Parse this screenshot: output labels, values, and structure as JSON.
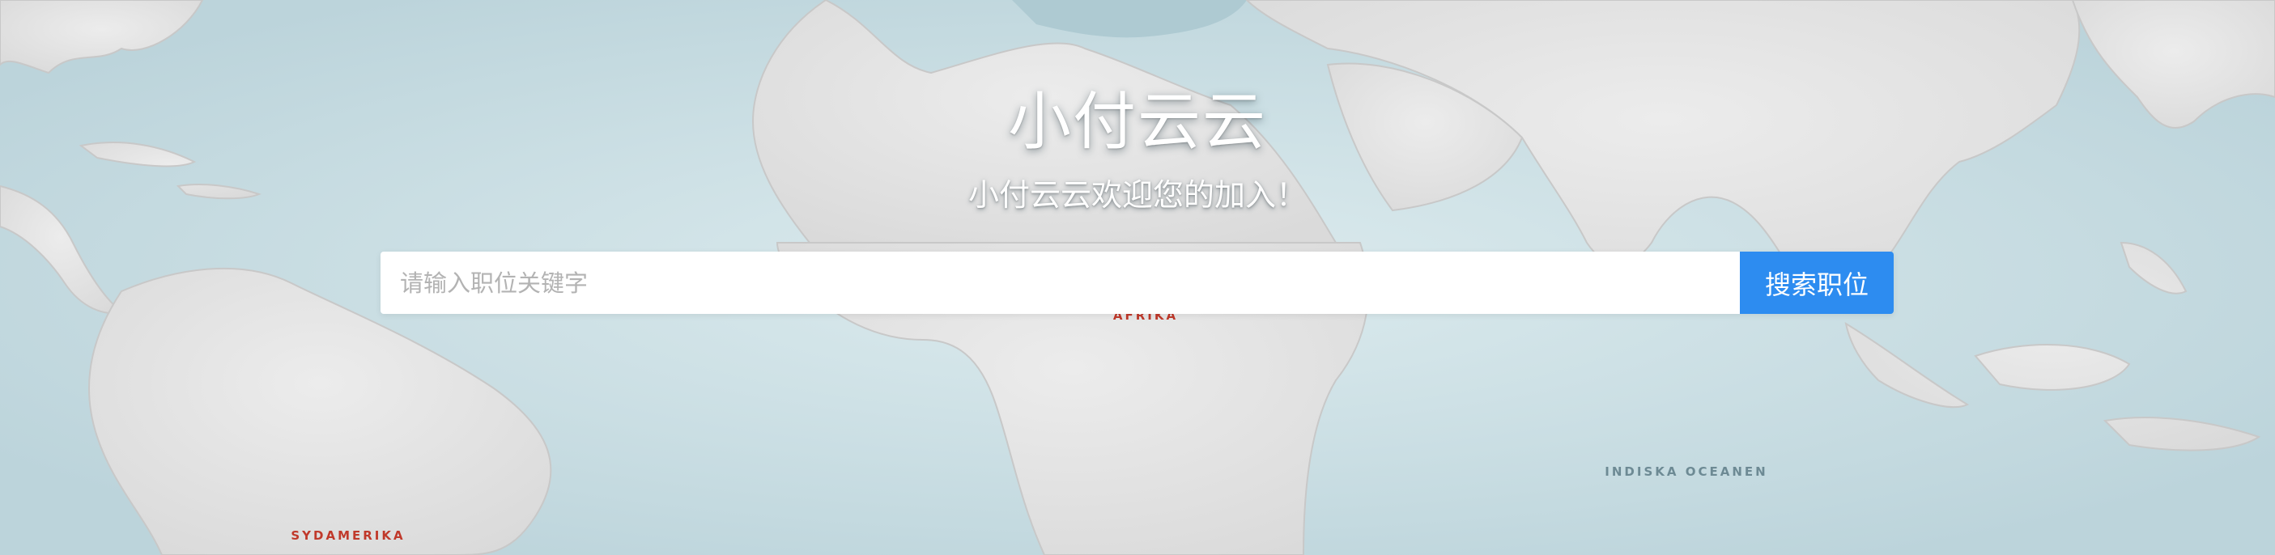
{
  "hero": {
    "title": "小付云云",
    "subtitle": "小付云云欢迎您的加入！"
  },
  "search": {
    "placeholder": "请输入职位关键字",
    "button_label": "搜索职位"
  },
  "map_labels": {
    "africa": "AFRIKA",
    "south_america": "SYDAMERIKA",
    "indian_ocean": "INDISKA OCEANEN"
  },
  "colors": {
    "accent": "#2d8cf0",
    "ocean": "#cfe1e6",
    "land": "#e4e4e4",
    "map_label_red": "#c0392b"
  }
}
